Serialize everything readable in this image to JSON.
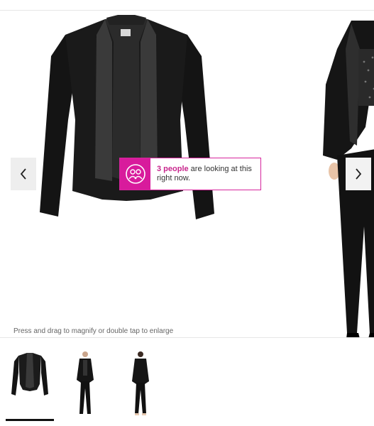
{
  "gallery": {
    "prev_icon": "chevron-left-icon",
    "next_icon": "chevron-right-icon"
  },
  "notice": {
    "icon": "people-icon",
    "count_text": "3 people",
    "rest_text": " are looking at this right now.",
    "accent": "#d81b9c"
  },
  "hint": "Press and drag to magnify or double tap to enlarge",
  "thumbnails": [
    {
      "label": "jacket-front-thumbnail",
      "active": true
    },
    {
      "label": "model-front-thumbnail",
      "active": false
    },
    {
      "label": "model-back-thumbnail",
      "active": false
    }
  ]
}
